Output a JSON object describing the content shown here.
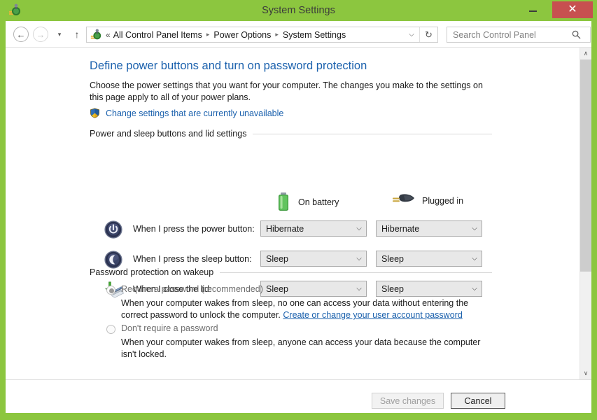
{
  "window": {
    "title": "System Settings",
    "icon": "power-options-icon",
    "controls": {
      "minimize": "minimize-button",
      "maximize": "maximize-button",
      "close_glyph": "✕"
    },
    "accent_green": "#8cc63f",
    "close_red": "#c75050"
  },
  "navbar": {
    "back": "←",
    "forward": "→",
    "recent_locations": "▾",
    "up": "↑",
    "separator_double": "«",
    "separator_arrow": "▸",
    "dropdown": "⌵",
    "refresh": "↻",
    "breadcrumbs": [
      "All Control Panel Items",
      "Power Options",
      "System Settings"
    ],
    "search": {
      "placeholder": "Search Control Panel",
      "value": "",
      "icon": "search-icon"
    }
  },
  "page": {
    "heading": "Define power buttons and turn on password protection",
    "description": "Choose the power settings that you want for your computer. The changes you make to the settings on this page apply to all of your power plans.",
    "uac_link": "Change settings that are currently unavailable"
  },
  "power_section": {
    "group_title": "Power and sleep buttons and lid settings",
    "columns": [
      {
        "label": "On battery",
        "icon": "battery-icon"
      },
      {
        "label": "Plugged in",
        "icon": "power-plug-icon"
      }
    ],
    "rows": [
      {
        "icon": "power-button-icon",
        "label": "When I press the power button:",
        "on_battery": "Hibernate",
        "plugged_in": "Hibernate"
      },
      {
        "icon": "sleep-button-icon",
        "label": "When I press the sleep button:",
        "on_battery": "Sleep",
        "plugged_in": "Sleep"
      },
      {
        "icon": "laptop-lid-icon",
        "label": "When I close the lid:",
        "on_battery": "Sleep",
        "plugged_in": "Sleep"
      }
    ],
    "dropdown_arrow": "⌵"
  },
  "password_section": {
    "group_title": "Password protection on wakeup",
    "options": [
      {
        "label": "Require a password (recommended)",
        "selected": true,
        "description_before_link": "When your computer wakes from sleep, no one can access your data without entering the correct password to unlock the computer. ",
        "link": "Create or change your user account password"
      },
      {
        "label": "Don't require a password",
        "selected": false,
        "description": "When your computer wakes from sleep, anyone can access your data because the computer isn't locked."
      }
    ]
  },
  "footer": {
    "save_label": "Save changes",
    "save_enabled": false,
    "cancel_label": "Cancel"
  },
  "scrollbar": {
    "up_arrow": "∧",
    "down_arrow": "∨"
  }
}
